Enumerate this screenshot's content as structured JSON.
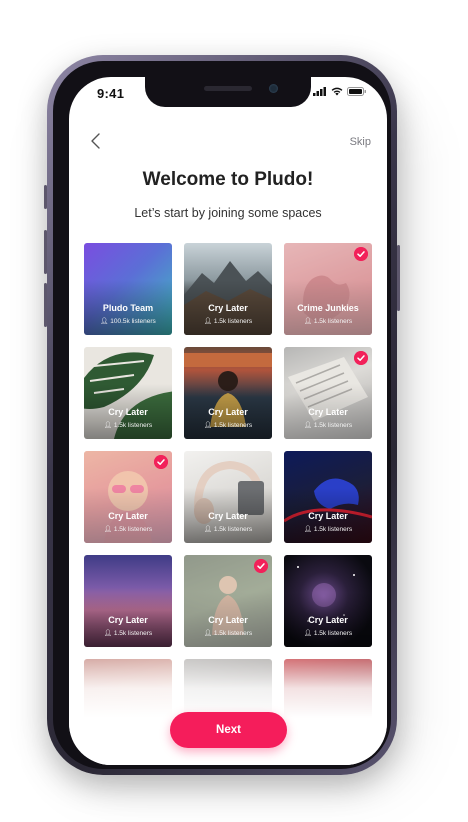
{
  "status_bar": {
    "time": "9:41"
  },
  "nav": {
    "skip_label": "Skip"
  },
  "header": {
    "title": "Welcome to Pludo!",
    "subtitle": "Let’s start by joining some spaces"
  },
  "spaces": [
    {
      "name": "Pludo Team",
      "listeners": "100.5k listeners",
      "selected": false
    },
    {
      "name": "Cry Later",
      "listeners": "1.5k listeners",
      "selected": false
    },
    {
      "name": "Crime Junkies",
      "listeners": "1.5k listeners",
      "selected": true
    },
    {
      "name": "Cry Later",
      "listeners": "1.5k listeners",
      "selected": false
    },
    {
      "name": "Cry Later",
      "listeners": "1.5k listeners",
      "selected": false
    },
    {
      "name": "Cry Later",
      "listeners": "1.5k listeners",
      "selected": true
    },
    {
      "name": "Cry Later",
      "listeners": "1.5k listeners",
      "selected": true
    },
    {
      "name": "Cry Later",
      "listeners": "1.5k listeners",
      "selected": false
    },
    {
      "name": "Cry Later",
      "listeners": "1.5k listeners",
      "selected": false
    },
    {
      "name": "Cry Later",
      "listeners": "1.5k listeners",
      "selected": false
    },
    {
      "name": "Cry Later",
      "listeners": "1.5k listeners",
      "selected": true
    },
    {
      "name": "Cry Later",
      "listeners": "1.5k listeners",
      "selected": false
    }
  ],
  "footer": {
    "next_label": "Next"
  },
  "colors": {
    "accent": "#f51d5b",
    "check": "#f2215a"
  },
  "icons": {
    "back": "chevron-left-icon",
    "check": "checkmark-icon",
    "listeners": "user-icon"
  }
}
